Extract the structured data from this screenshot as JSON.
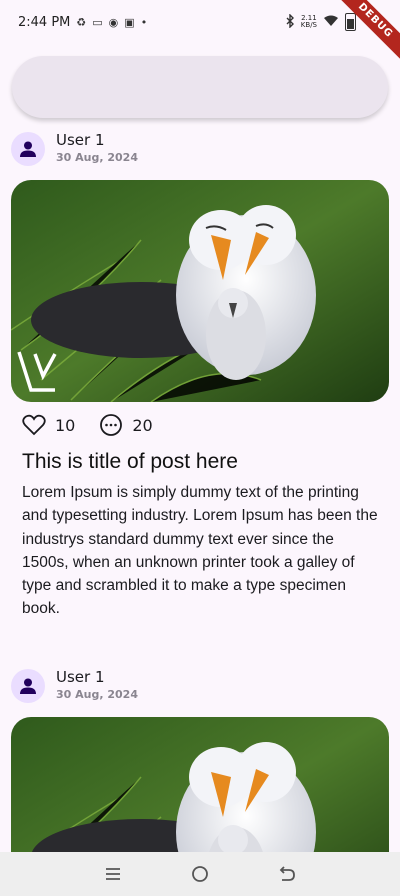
{
  "status_bar": {
    "time": "2:44 PM",
    "notification_icons": [
      "recycle-icon",
      "screen-icon",
      "messenger-icon",
      "facebook-icon"
    ],
    "dot": "•",
    "net_speed_top": "2.11",
    "net_speed_bottom": "KB/S",
    "debug_label": "DEBUG"
  },
  "search": {
    "placeholder": ""
  },
  "posts": [
    {
      "user": "User 1",
      "date": "30 Aug, 2024",
      "likes": "10",
      "comments": "20",
      "title": "This is title of post here",
      "body": "Lorem Ipsum is simply dummy text of the printing and typesetting industry. Lorem Ipsum has been the industrys standard dummy text ever since the 1500s, when an unknown printer took a galley of type and scrambled it to make a type specimen book.",
      "image_watermark": "LV"
    },
    {
      "user": "User 1",
      "date": "30 Aug, 2024"
    }
  ],
  "colors": {
    "background": "#fcf6fd",
    "search_bar": "#ebe4ee",
    "avatar_bg": "#eaddff",
    "avatar_fg": "#21005d",
    "debug_ribbon": "#b3261e"
  }
}
